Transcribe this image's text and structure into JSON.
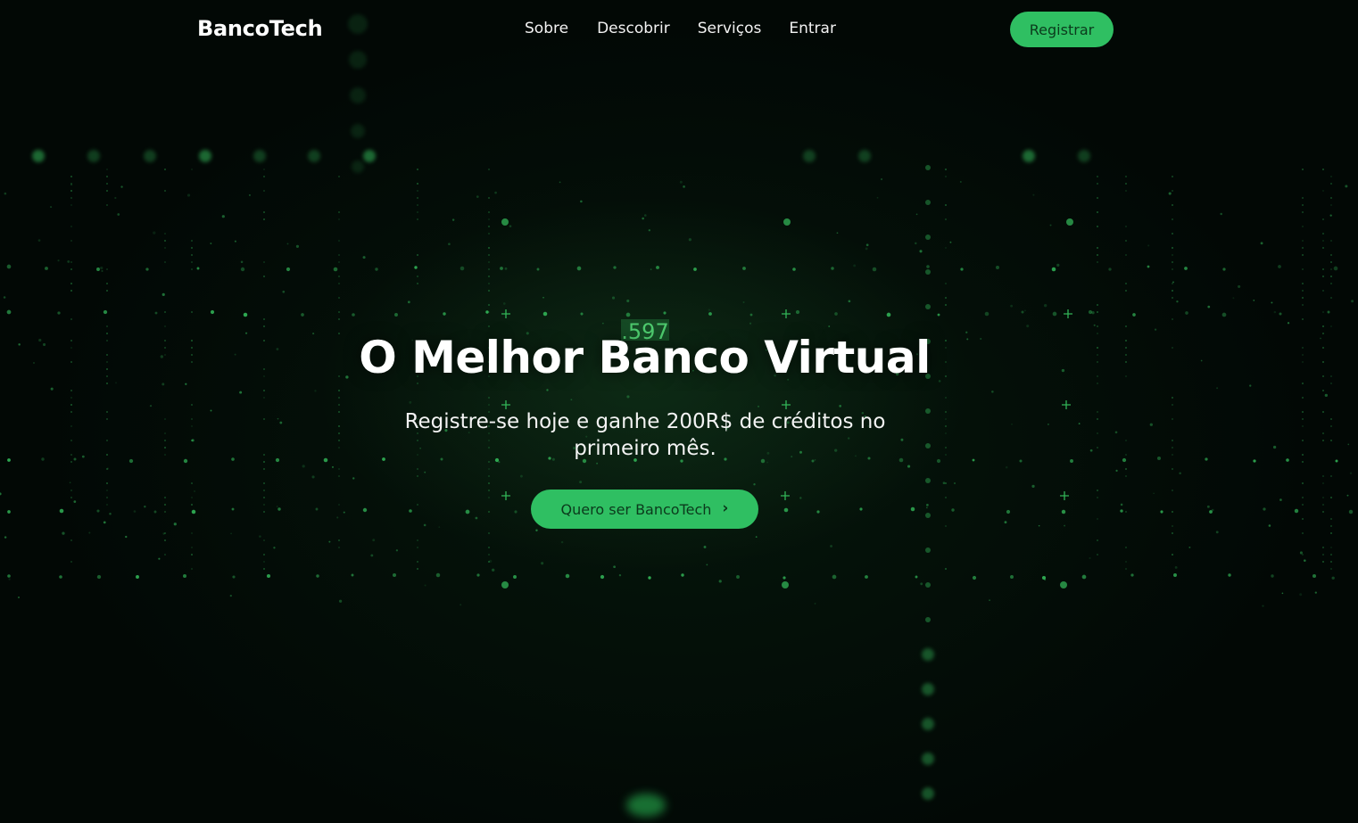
{
  "navbar": {
    "brand": "BancoTech",
    "links": [
      "Sobre",
      "Descobrir",
      "Serviços",
      "Entrar"
    ],
    "register_label": "Registrar"
  },
  "hero": {
    "title": "O Melhor Banco Virtual",
    "subtitle": "Registre-se hoje e ganhe 200R$ de créditos no primeiro mês.",
    "cta_label": "Quero ser BancoTech",
    "cta_icon": "chevron-right-icon",
    "background_number": ".597"
  },
  "colors": {
    "accent": "#2fbf62",
    "button_text": "#0b3a1c",
    "background": "#020805",
    "glow": "#3ddc6a"
  }
}
